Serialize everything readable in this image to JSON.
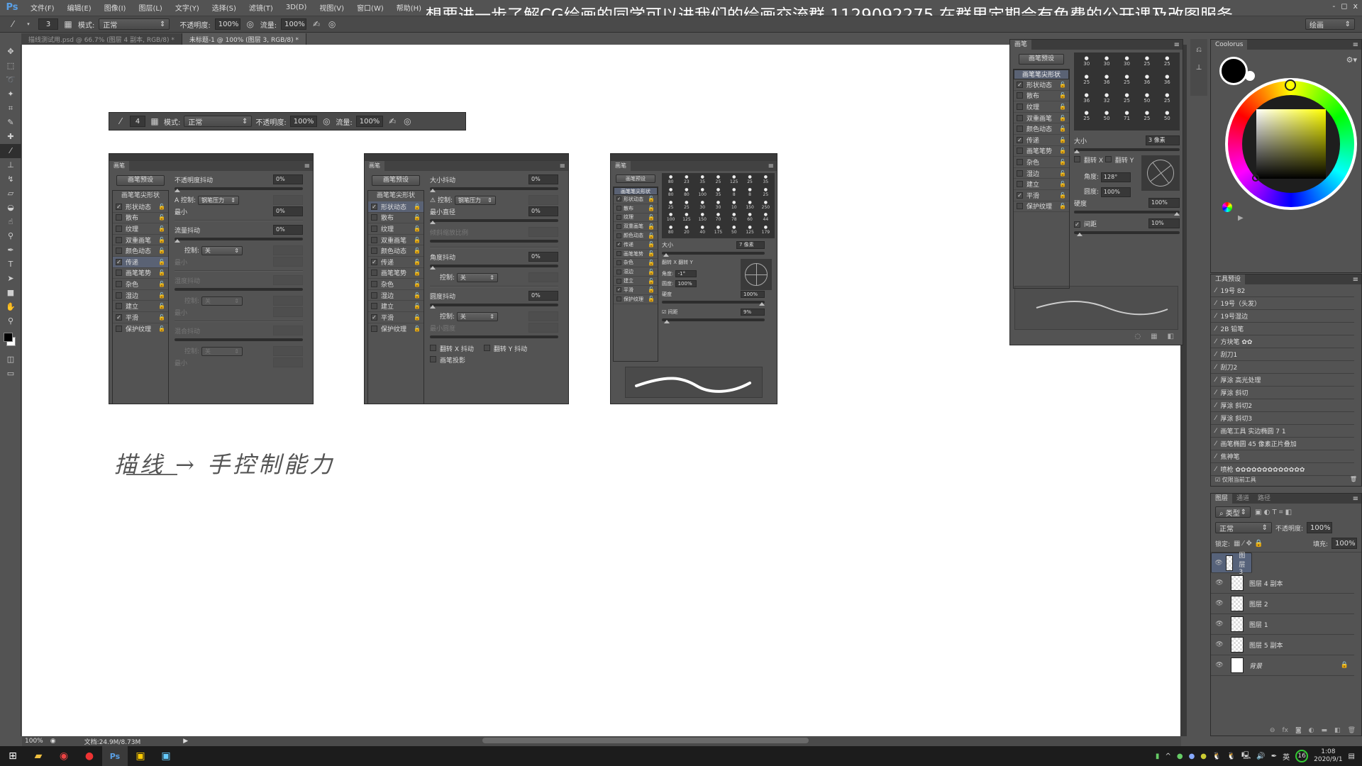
{
  "app": {
    "logo": "Ps",
    "menu": [
      "文件(F)",
      "编辑(E)",
      "图像(I)",
      "图层(L)",
      "文字(Y)",
      "选择(S)",
      "滤镜(T)",
      "3D(D)",
      "视图(V)",
      "窗口(W)",
      "帮助(H)"
    ],
    "banner": "想要进一步了解CG绘画的同学可以进我们的绘画交流群 1129092275 在群里定期会有免费的公开课及改图服务",
    "window_buttons": [
      "-",
      "◻",
      "x"
    ],
    "workspace": "绘画"
  },
  "options_bar": {
    "brush_size": "3",
    "mode_label": "模式:",
    "mode_value": "正常",
    "opacity_label": "不透明度:",
    "opacity_value": "100%",
    "flow_label": "流量:",
    "flow_value": "100%"
  },
  "doc_tabs": [
    {
      "label": "描线测试用.psd @ 66.7% (图层 4 副本, RGB/8) *",
      "active": false
    },
    {
      "label": "未标题-1 @ 100% (图层 3, RGB/8) *",
      "active": true
    }
  ],
  "tools": [
    "move",
    "marquee",
    "lasso",
    "magic-wand",
    "crop",
    "eyedropper",
    "healing",
    "brush",
    "stamp",
    "history-brush",
    "eraser",
    "bucket",
    "blur",
    "dodge",
    "pen",
    "type",
    "path-select",
    "shape",
    "hand",
    "zoom"
  ],
  "canvas": {
    "embedded_toolbar": {
      "brush_size": "4",
      "mode_label": "模式:",
      "mode_value": "正常",
      "opacity_label": "不透明度:",
      "opacity_value": "100%",
      "flow_label": "流量:",
      "flow_value": "100%"
    },
    "handwriting": "描线 → 手控制能力"
  },
  "brush_panel_common": {
    "tab": "画笔",
    "preset_button": "画笔预设",
    "tip_shape": "画笔笔尖形状",
    "items": [
      {
        "label": "形状动态",
        "checked": true
      },
      {
        "label": "散布",
        "checked": false
      },
      {
        "label": "纹理",
        "checked": false
      },
      {
        "label": "双重画笔",
        "checked": false
      },
      {
        "label": "颜色动态",
        "checked": false
      },
      {
        "label": "传递",
        "checked": true
      },
      {
        "label": "画笔笔势",
        "checked": false
      },
      {
        "label": "杂色",
        "checked": false
      },
      {
        "label": "湿边",
        "checked": false
      },
      {
        "label": "建立",
        "checked": false
      },
      {
        "label": "平滑",
        "checked": true
      },
      {
        "label": "保护纹理",
        "checked": false
      }
    ]
  },
  "panel_transfer": {
    "opacity_jitter": "不透明度抖动",
    "opacity_jitter_value": "0%",
    "control": "控制:",
    "control_value": "钢笔压力",
    "min": "最小",
    "min_value": "0%",
    "flow_jitter": "流量抖动",
    "flow_jitter_value": "0%",
    "control2_value": "关",
    "wet_jitter": "湿度抖动",
    "mix_jitter": "混合抖动",
    "control3_value": "关",
    "control4_value": "关"
  },
  "panel_shape": {
    "size_jitter": "大小抖动",
    "size_jitter_value": "0%",
    "control": "控制:",
    "control_value": "钢笔压力",
    "min_diameter": "最小直径",
    "min_diameter_value": "0%",
    "tilt_scale": "倾斜缩放比例",
    "angle_jitter": "角度抖动",
    "angle_jitter_value": "0%",
    "angle_control_value": "关",
    "round_jitter": "圆度抖动",
    "round_jitter_value": "0%",
    "round_control_value": "关",
    "min_roundness": "最小圆度",
    "flip_x": "翻转 X 抖动",
    "flip_y": "翻转 Y 抖动",
    "projection": "画笔投影"
  },
  "panel_tip_small": {
    "grid_sizes": [
      "80",
      "23",
      "35",
      "25",
      "125",
      "25",
      "35",
      "80",
      "80",
      "100",
      "35",
      "8",
      "8",
      "25",
      "25",
      "25",
      "30",
      "30",
      "10",
      "150",
      "250",
      "100",
      "125",
      "150",
      "70",
      "78",
      "60",
      "44",
      "80",
      "20",
      "40",
      "175",
      "50",
      "125",
      "179"
    ],
    "size_label": "大小",
    "size_value": "7 像素",
    "flip_x": "翻转 X",
    "flip_y": "翻转 Y",
    "angle_label": "角度:",
    "angle_value": "-1°",
    "round_label": "圆度:",
    "round_value": "100%",
    "hardness_label": "硬度",
    "hardness_value": "100%",
    "spacing_label": "间距",
    "spacing_value": "9%"
  },
  "brush_panel_main": {
    "grid_sizes": [
      "30",
      "30",
      "30",
      "25",
      "25",
      "25",
      "36",
      "25",
      "36",
      "36",
      "36",
      "32",
      "25",
      "50",
      "25",
      "25",
      "50",
      "71",
      "25",
      "50"
    ],
    "size_label": "大小",
    "size_value": "3 像素",
    "flip_x": "翻转 X",
    "flip_y": "翻转 Y",
    "angle_label": "角度:",
    "angle_value": "128°",
    "round_label": "圆度:",
    "round_value": "100%",
    "hardness_label": "硬度",
    "hardness_value": "100%",
    "spacing_label": "间距",
    "spacing_value": "10%"
  },
  "coolorus": {
    "tab": "Coolorus",
    "fg_color": "#000000",
    "bg_color": "#ffffff",
    "hue_color": "#ffff00"
  },
  "tool_presets": {
    "tab": "工具预设",
    "items": [
      "19号 82",
      "19号（头发）",
      "19号湿边",
      "2B 铅笔",
      "方块笔 ✿✿",
      "刮刀1",
      "刮刀2",
      "厚涂 高光处理",
      "厚涂 斜切",
      "厚涂 斜切2",
      "厚涂 斜切3",
      "画笔工具 实边椭圆 7 1",
      "画笔椭圆 45 像素正片叠加",
      "焦神笔",
      "喷枪 ✿✿✿✿✿✿✿✿✿✿✿✿✿"
    ],
    "current_only": "仅限当前工具"
  },
  "layers": {
    "tabs": [
      "图层",
      "通道",
      "路径"
    ],
    "filter": "类型",
    "blend": "正常",
    "opacity_label": "不透明度:",
    "opacity_value": "100%",
    "lock_label": "锁定:",
    "fill_label": "填充:",
    "fill_value": "100%",
    "items": [
      {
        "name": "图层 3",
        "selected": true
      },
      {
        "name": "图层 4 副本",
        "selected": false
      },
      {
        "name": "图层 2",
        "selected": false
      },
      {
        "name": "图层 1",
        "selected": false
      },
      {
        "name": "图层 5 副本",
        "selected": false
      },
      {
        "name": "背景",
        "selected": false,
        "locked": true
      }
    ]
  },
  "status": {
    "zoom": "100%",
    "doc": "文档:24.9M/8.73M"
  },
  "taskbar": {
    "apps": [
      "windows-start",
      "file-explorer",
      "chrome",
      "netease-music",
      "photoshop",
      "paint-app",
      "image-viewer"
    ],
    "lang": "英",
    "badge": "16",
    "time": "1:08",
    "date": "2020/9/1"
  }
}
